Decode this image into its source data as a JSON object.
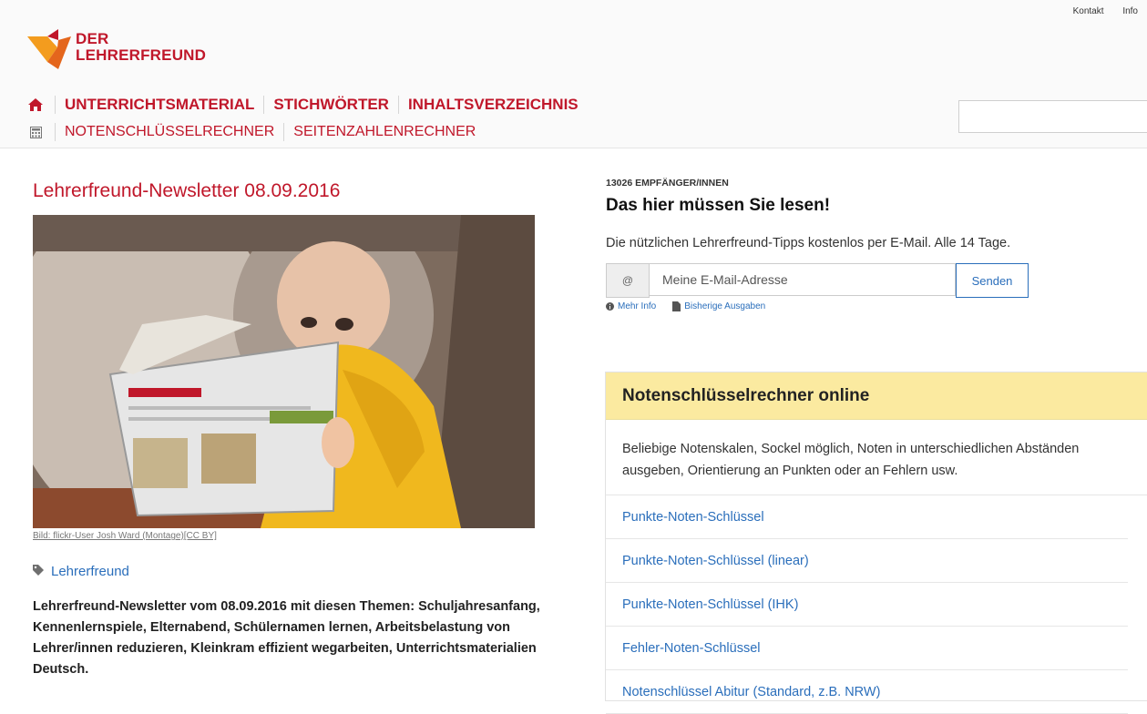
{
  "header": {
    "top_links": [
      "Kontakt",
      "Info"
    ],
    "logo_line1": "DER",
    "logo_line2": "LEHRERFREUND",
    "nav_primary": [
      "UNTERRICHTSMATERIAL",
      "STICHWÖRTER",
      "INHALTSVERZEICHNIS"
    ],
    "nav_secondary": [
      "NOTENSCHLÜSSELRECHNER",
      "SEITENZAHLENRECHNER"
    ],
    "brand_color": "#c0172a",
    "search_value": ""
  },
  "article": {
    "title": "Lehrerfreund-Newsletter 08.09.2016",
    "image_caption": "Bild: flickr-User Josh Ward (Montage)[CC BY]",
    "tag": "Lehrerfreund",
    "summary": "Lehrerfreund-Newsletter vom 08.09.2016 mit diesen Themen: Schuljahresanfang, Kennenlernspiele, Elternabend, Schülernamen lernen, Arbeitsbelastung von Lehrer/innen reduzieren, Kleinkram effizient wegarbeiten, Unterrichtsmaterialien Deutsch."
  },
  "newsletter": {
    "count": "13026 EMPFÄNGER/INNEN",
    "heading": "Das hier müssen Sie lesen!",
    "description": "Die nützlichen Lehrerfreund-Tipps kostenlos per E-Mail. Alle 14 Tage.",
    "at_symbol": "@",
    "email_placeholder": "Meine E-Mail-Adresse",
    "send_label": "Senden",
    "more_info": "Mehr Info",
    "past_issues": "Bisherige Ausgaben"
  },
  "calculator_panel": {
    "title": "Notenschlüsselrechner online",
    "description": "Beliebige Notenskalen, Sockel möglich, Noten in unterschiedlichen Abständen ausgeben, Orientierung an Punkten oder an Fehlern usw.",
    "links": [
      "Punkte-Noten-Schlüssel",
      "Punkte-Noten-Schlüssel (linear)",
      "Punkte-Noten-Schlüssel (IHK)",
      "Fehler-Noten-Schlüssel",
      "Notenschlüssel Abitur (Standard, z.B. NRW)"
    ],
    "header_color": "#fbeaa0"
  }
}
